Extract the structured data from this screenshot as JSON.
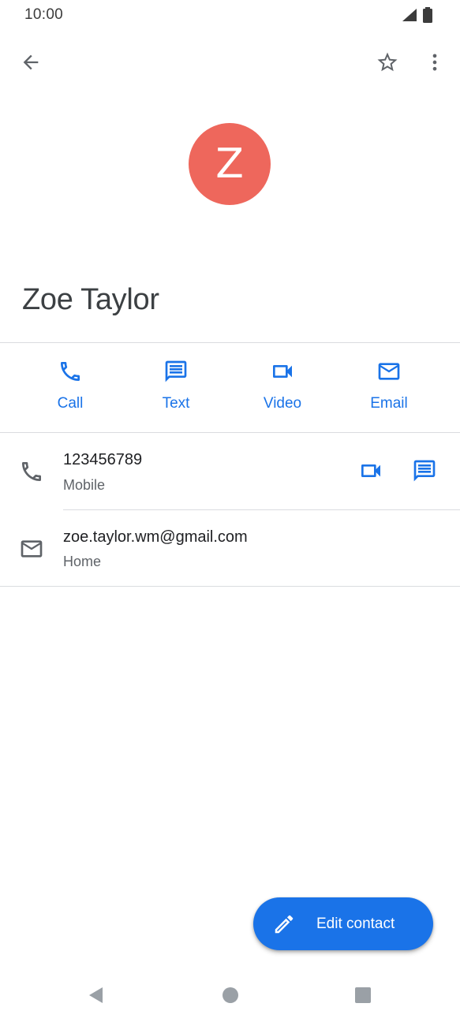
{
  "status_bar": {
    "time": "10:00"
  },
  "top_bar": {
    "back_icon": "arrow-back-icon",
    "favorite_icon": "star-outline-icon",
    "more_icon": "more-vert-icon"
  },
  "contact": {
    "initial": "Z",
    "name": "Zoe Taylor",
    "avatar_color": "#ee675c"
  },
  "actions": [
    {
      "label": "Call",
      "icon": "phone-icon"
    },
    {
      "label": "Text",
      "icon": "message-icon"
    },
    {
      "label": "Video",
      "icon": "videocam-icon"
    },
    {
      "label": "Email",
      "icon": "email-icon"
    }
  ],
  "details": {
    "phone": {
      "value": "123456789",
      "type": "Mobile"
    },
    "email": {
      "value": "zoe.taylor.wm@gmail.com",
      "type": "Home"
    }
  },
  "fab": {
    "label": "Edit contact",
    "icon": "edit-pencil-icon",
    "color": "#1a73e8"
  },
  "colors": {
    "accent": "#1a73e8",
    "icon_gray": "#5f6368"
  }
}
